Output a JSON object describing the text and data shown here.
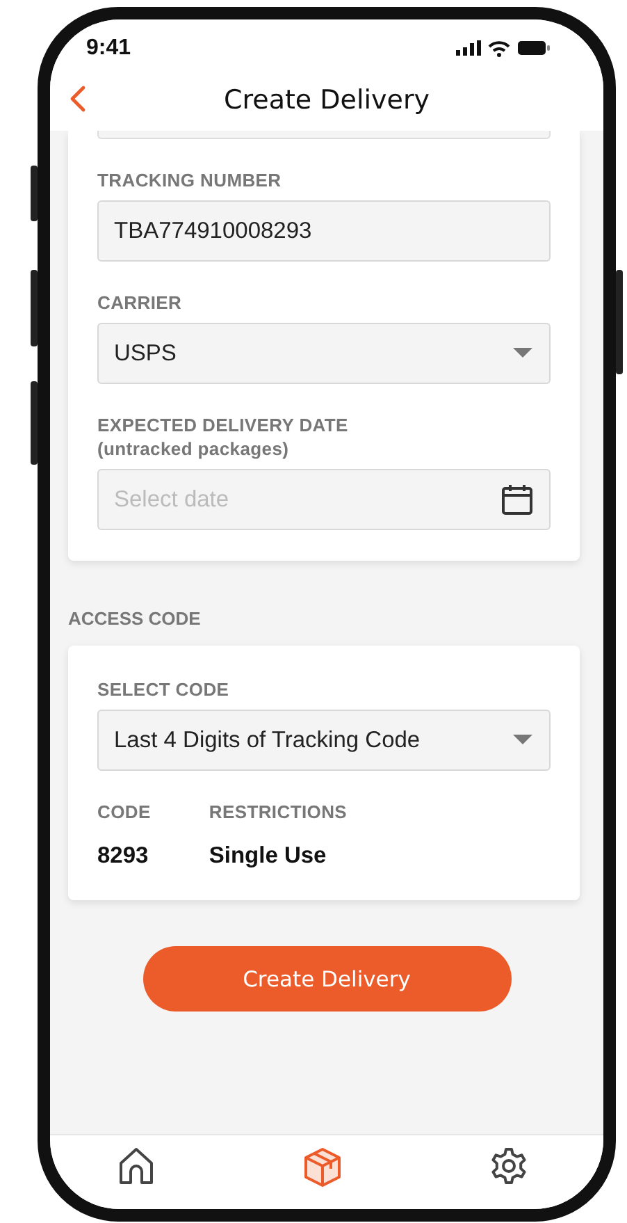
{
  "status_bar": {
    "time": "9:41"
  },
  "header": {
    "title": "Create Delivery"
  },
  "delivery_fields": [
    {
      "kind": "text",
      "label": "TRACKING NUMBER",
      "value": "TBA774910008293"
    },
    {
      "kind": "select",
      "label": "CARRIER",
      "value": "USPS"
    },
    {
      "kind": "date",
      "label": "EXPECTED DELIVERY DATE",
      "sublabel": "(untracked packages)",
      "placeholder": "Select date"
    }
  ],
  "access_code": {
    "title": "ACCESS CODE",
    "select": {
      "label": "SELECT CODE",
      "value": "Last 4 Digits of Tracking Code"
    },
    "details": [
      {
        "label": "CODE",
        "value": "8293"
      },
      {
        "label": "RESTRICTIONS",
        "value": "Single Use"
      }
    ]
  },
  "submit_button": "Create Delivery",
  "nav": [
    {
      "kind": "home",
      "selected": false
    },
    {
      "kind": "package",
      "selected": true
    },
    {
      "kind": "settings",
      "selected": false
    }
  ]
}
